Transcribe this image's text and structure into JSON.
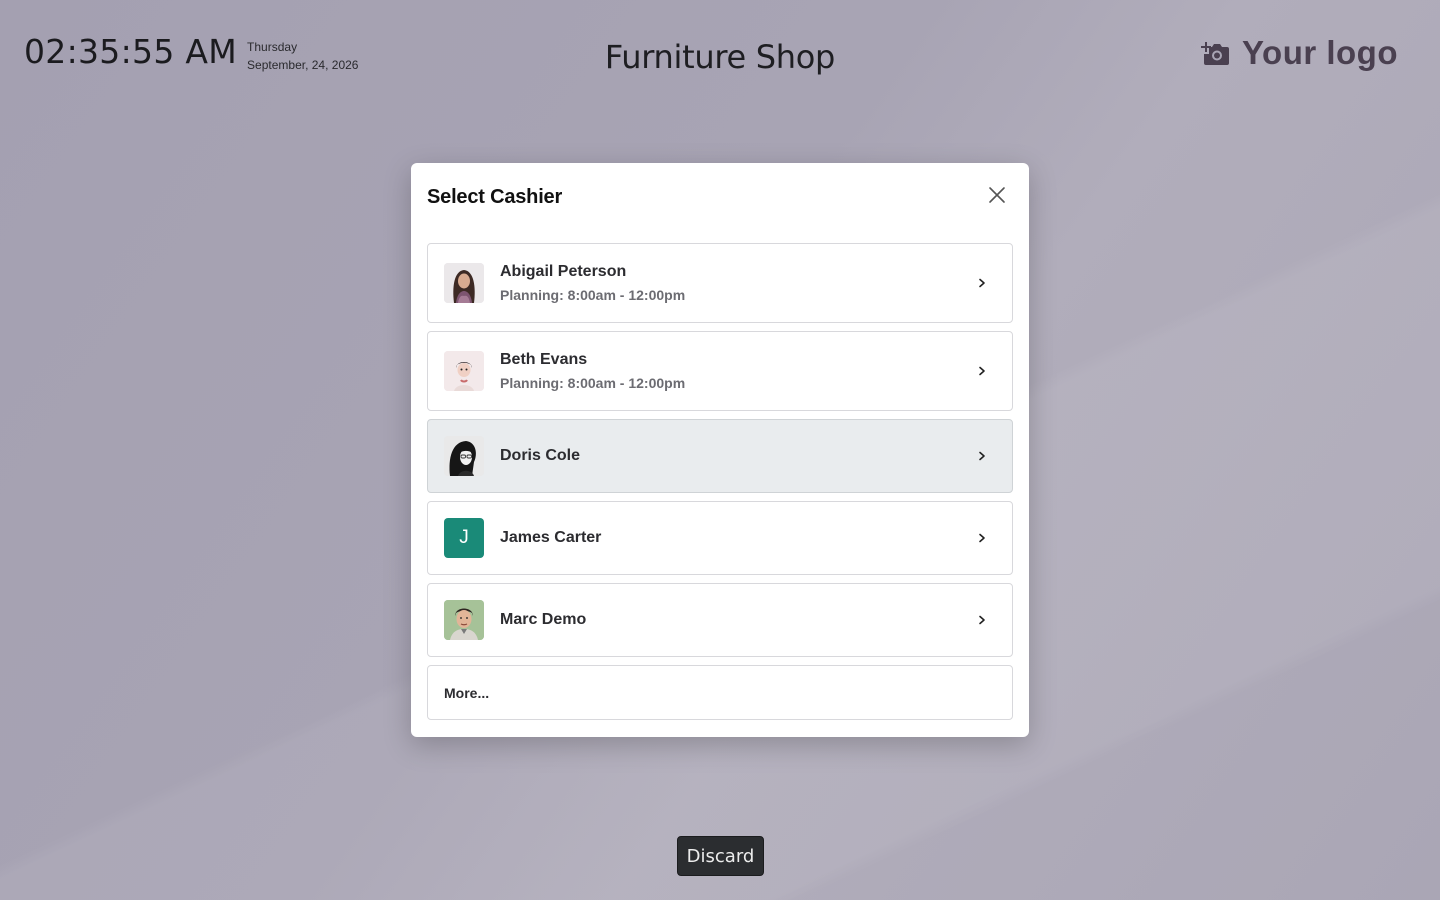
{
  "header": {
    "time": "02:35:55 AM",
    "day": "Thursday",
    "date": "September, 24, 2026",
    "shop_name": "Furniture Shop",
    "logo_text": "Your logo",
    "logo_icon": "camera-add-icon"
  },
  "dialog": {
    "title": "Select Cashier",
    "close_icon": "close-icon",
    "cashiers": [
      {
        "name": "Abigail Peterson",
        "planning": "Planning: 8:00am - 12:00pm",
        "avatar": "photo"
      },
      {
        "name": "Beth Evans",
        "planning": "Planning: 8:00am - 12:00pm",
        "avatar": "photo"
      },
      {
        "name": "Doris Cole",
        "planning": "",
        "avatar": "photo",
        "highlighted": true
      },
      {
        "name": "James Carter",
        "planning": "",
        "avatar": "initial",
        "initial": "J",
        "avatar_color": "#1a8a78"
      },
      {
        "name": "Marc Demo",
        "planning": "",
        "avatar": "photo"
      }
    ],
    "more_label": "More..."
  },
  "footer": {
    "discard_label": "Discard"
  },
  "colors": {
    "background": "#a8a4b4",
    "dialog_bg": "#ffffff",
    "highlight_row": "#e9ecee",
    "discard_bg": "#2b2d30",
    "initial_avatar": "#1a8a78"
  }
}
